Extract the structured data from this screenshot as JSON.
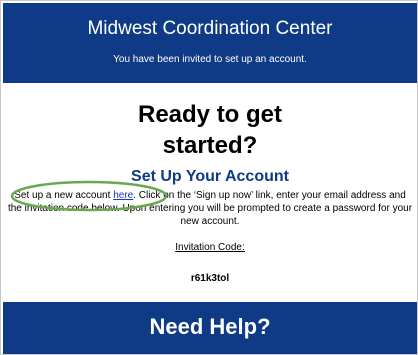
{
  "header": {
    "title": "Midwest Coordination Center",
    "subtitle": "You have been invited to set up an account."
  },
  "main": {
    "heading_line1": "Ready to get",
    "heading_line2": "started?",
    "section_title": "Set Up Your Account",
    "instructions_before_link": "Set up a new account ",
    "link_text": "here",
    "instructions_after_link": ". Click on the ‘Sign up now’ link, enter your email address and the invitation code below. Upon entering you will be prompted to create a password for your new account.",
    "code_label": "Invitation Code:",
    "code_value": "r61k3tol"
  },
  "footer": {
    "title": "Need Help?"
  },
  "colors": {
    "brand_blue": "#0f3a86",
    "link_blue": "#1a35c8",
    "highlight_green": "#6aa84f"
  }
}
